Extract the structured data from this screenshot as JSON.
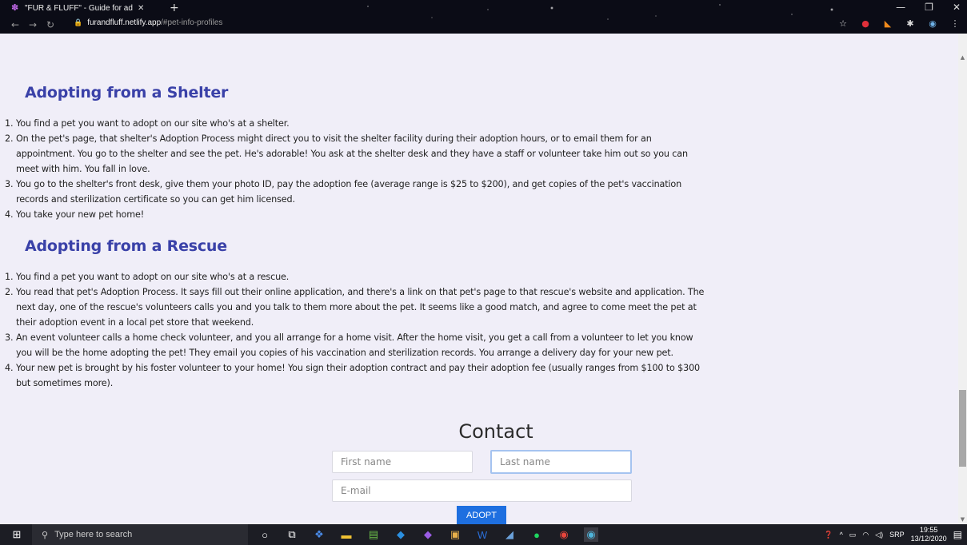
{
  "browser": {
    "tab_title": "\"FUR & FLUFF\" - Guide for adopt",
    "tab_close": "✕",
    "new_tab": "+",
    "url_host": "furandfluff.netlify.app",
    "url_path": "/#pet-info-profiles"
  },
  "page": {
    "shelter": {
      "title": "Adopting from a Shelter",
      "steps": [
        "You find a pet you want to adopt on our site who's at a shelter.",
        "On the pet's page, that shelter's Adoption Process might direct you to visit the shelter facility during their adoption hours, or to email them for an appointment. You go to the shelter and see the pet. He's adorable! You ask at the shelter desk and they have a staff or volunteer take him out so you can meet with him. You fall in love.",
        "You go to the shelter's front desk, give them your photo ID, pay the adoption fee (average range is $25 to $200), and get copies of the pet's vaccination records and sterilization certificate so you can get him licensed.",
        "You take your new pet home!"
      ]
    },
    "rescue": {
      "title": "Adopting from a Rescue",
      "steps": [
        "You find a pet you want to adopt on our site who's at a rescue.",
        "You read that pet's Adoption Process. It says fill out their online application, and there's a link on that pet's page to that rescue's website and application. The next day, one of the rescue's volunteers calls you and you talk to them more about the pet. It seems like a good match, and agree to come meet the pet at their adoption event in a local pet store that weekend.",
        "An event volunteer calls a home check volunteer, and you all arrange for a home visit. After the home visit, you get a call from a volunteer to let you know you will be the home adopting the pet! They email you copies of his vaccination and sterilization records. You arrange a delivery day for your new pet.",
        "Your new pet is brought by his foster volunteer to your home! You sign their adoption contract and pay their adoption fee (usually ranges from $100 to $300 but sometimes more)."
      ]
    },
    "contact": {
      "title": "Contact",
      "first_name_placeholder": "First name",
      "last_name_placeholder": "Last name",
      "email_placeholder": "E-mail",
      "submit_label": "ADOPT"
    }
  },
  "taskbar": {
    "search_placeholder": "Type here to search",
    "language": "SRP",
    "time": "19:55",
    "date": "13/12/2020"
  }
}
